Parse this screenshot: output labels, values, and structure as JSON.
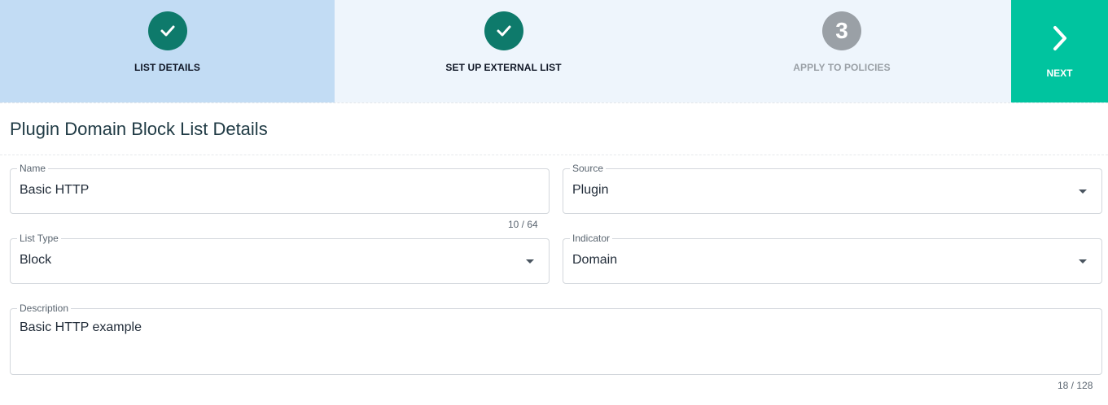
{
  "stepper": {
    "steps": [
      {
        "label": "LIST DETAILS",
        "status": "complete"
      },
      {
        "label": "SET UP EXTERNAL LIST",
        "status": "complete"
      },
      {
        "label": "APPLY TO POLICIES",
        "number": "3",
        "status": "pending"
      }
    ],
    "next_label": "NEXT"
  },
  "page": {
    "title": "Plugin Domain Block List Details"
  },
  "form": {
    "name": {
      "label": "Name",
      "value": "Basic HTTP",
      "counter": "10 / 64"
    },
    "source": {
      "label": "Source",
      "value": "Plugin"
    },
    "list_type": {
      "label": "List Type",
      "value": "Block"
    },
    "indicator": {
      "label": "Indicator",
      "value": "Domain"
    },
    "description": {
      "label": "Description",
      "value": "Basic HTTP example",
      "counter": "18 / 128"
    }
  },
  "colors": {
    "active_step_bg": "#c2dcf4",
    "step_bg": "#eef5fc",
    "complete_circle": "#0e7a6b",
    "pending_circle": "#9aa0a6",
    "next_button": "#00c49f"
  }
}
